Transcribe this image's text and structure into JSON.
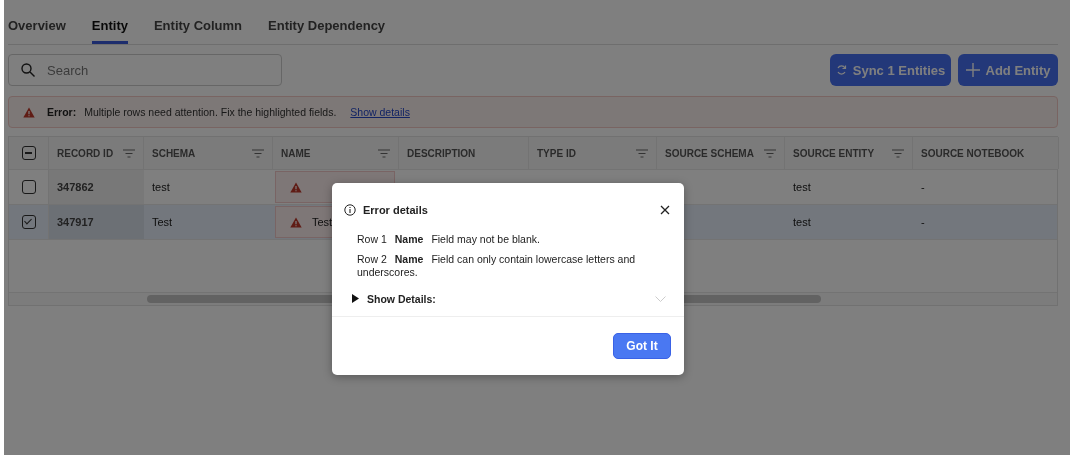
{
  "tabs": [
    {
      "label": "Overview",
      "selected": false
    },
    {
      "label": "Entity",
      "selected": true
    },
    {
      "label": "Entity Column",
      "selected": false
    },
    {
      "label": "Entity Dependency",
      "selected": false
    }
  ],
  "search": {
    "placeholder": "Search"
  },
  "actions": [
    {
      "label": "Sync 1 Entities",
      "kind": "sync"
    },
    {
      "label": "Add Entity",
      "kind": "add"
    }
  ],
  "banner": {
    "label": "Error:",
    "message": "Multiple rows need attention. Fix the highlighted fields.",
    "link": "Show details"
  },
  "table": {
    "select_all": {
      "partial": true
    },
    "columns": [
      {
        "label": "RECORD ID",
        "filterable": true
      },
      {
        "label": "SCHEMA",
        "filterable": true
      },
      {
        "label": "NAME",
        "filterable": true
      },
      {
        "label": "DESCRIPTION",
        "filterable": false
      },
      {
        "label": "TYPE ID",
        "filterable": true
      },
      {
        "label": "SOURCE SCHEMA",
        "filterable": true
      },
      {
        "label": "SOURCE ENTITY",
        "filterable": true
      },
      {
        "label": "SOURCE NOTEBOOK",
        "filterable": false
      }
    ],
    "rows": [
      {
        "selected": false,
        "name_error": true,
        "cells": [
          "347862",
          "test",
          null,
          null,
          null,
          null,
          "test",
          "-"
        ]
      },
      {
        "selected": true,
        "name_error": true,
        "cells": [
          "347917",
          "Test",
          "Test",
          null,
          null,
          null,
          "test",
          "-"
        ]
      }
    ]
  },
  "dialog": {
    "title": "Error details",
    "errors": [
      {
        "row": "Row 1",
        "field": "Name",
        "message": "Field may not be blank."
      },
      {
        "row": "Row 2",
        "field": "Name",
        "message": "Field can only contain lowercase letters and underscores."
      }
    ],
    "details": {
      "label": "Show Details:",
      "expanded": false
    },
    "button": "Got It"
  }
}
